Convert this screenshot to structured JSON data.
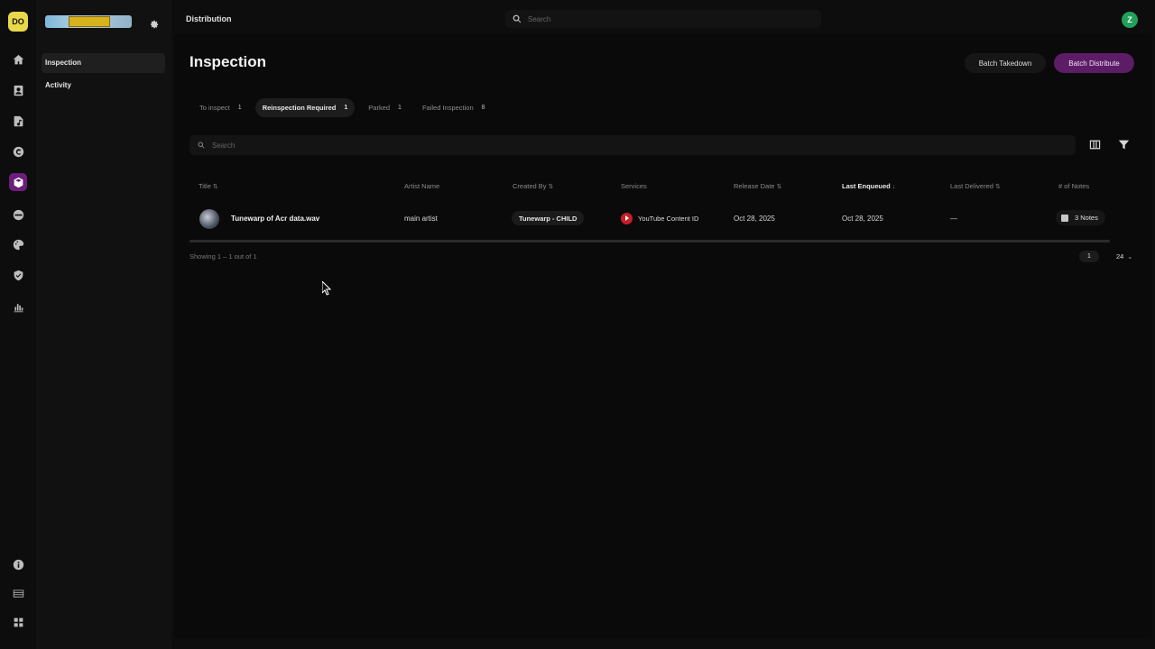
{
  "rail": {
    "logo_text": "DO",
    "icons": [
      "home-icon",
      "contact-card-icon",
      "music-file-icon",
      "copyright-icon",
      "cube-icon",
      "globe-icon",
      "palette-icon",
      "shield-icon",
      "bar-chart-icon",
      "info-icon",
      "table-icon",
      "grid-icon"
    ],
    "active": "cube-icon",
    "accent": "#6a1f7a"
  },
  "sidebar": {
    "items": [
      {
        "label": "Inspection",
        "active": true
      },
      {
        "label": "Activity",
        "active": false
      }
    ]
  },
  "topbar": {
    "section_title": "Distribution",
    "search_placeholder": "Search",
    "avatar_initial": "Z",
    "avatar_color": "#22a05a"
  },
  "page": {
    "title": "Inspection",
    "batch_takedown_label": "Batch Takedown",
    "batch_distribute_label": "Batch Distribute",
    "primary_color": "#5c1c66"
  },
  "tabs": [
    {
      "label": "To inspect",
      "count": "1",
      "active": false
    },
    {
      "label": "Reinspection Required",
      "count": "1",
      "active": true
    },
    {
      "label": "Parked",
      "count": "1",
      "active": false
    },
    {
      "label": "Failed Inspection",
      "count": "8",
      "active": false
    }
  ],
  "table": {
    "search_placeholder": "Search",
    "columns": [
      {
        "label": "Title",
        "sort": "⇅"
      },
      {
        "label": "Artist Name",
        "sort": ""
      },
      {
        "label": "Created By",
        "sort": "⇅"
      },
      {
        "label": "Services",
        "sort": ""
      },
      {
        "label": "Release Date",
        "sort": "⇅"
      },
      {
        "label": "Last Enqueued",
        "sort": "↓"
      },
      {
        "label": "Last Delivered",
        "sort": "⇅"
      },
      {
        "label": "# of Notes",
        "sort": ""
      }
    ],
    "rows": [
      {
        "title": "Tunewarp of Acr data.wav",
        "artist": "main artist",
        "created_by": "Tunewarp - CHILD",
        "service": "YouTube Content ID",
        "release_date": "Oct 28, 2025",
        "last_enqueued": "Oct 28, 2025",
        "last_delivered": "—",
        "notes": "3 Notes"
      }
    ],
    "footer": {
      "showing": "Showing 1 – 1 out of 1",
      "page": "1",
      "page_size": "24"
    }
  }
}
